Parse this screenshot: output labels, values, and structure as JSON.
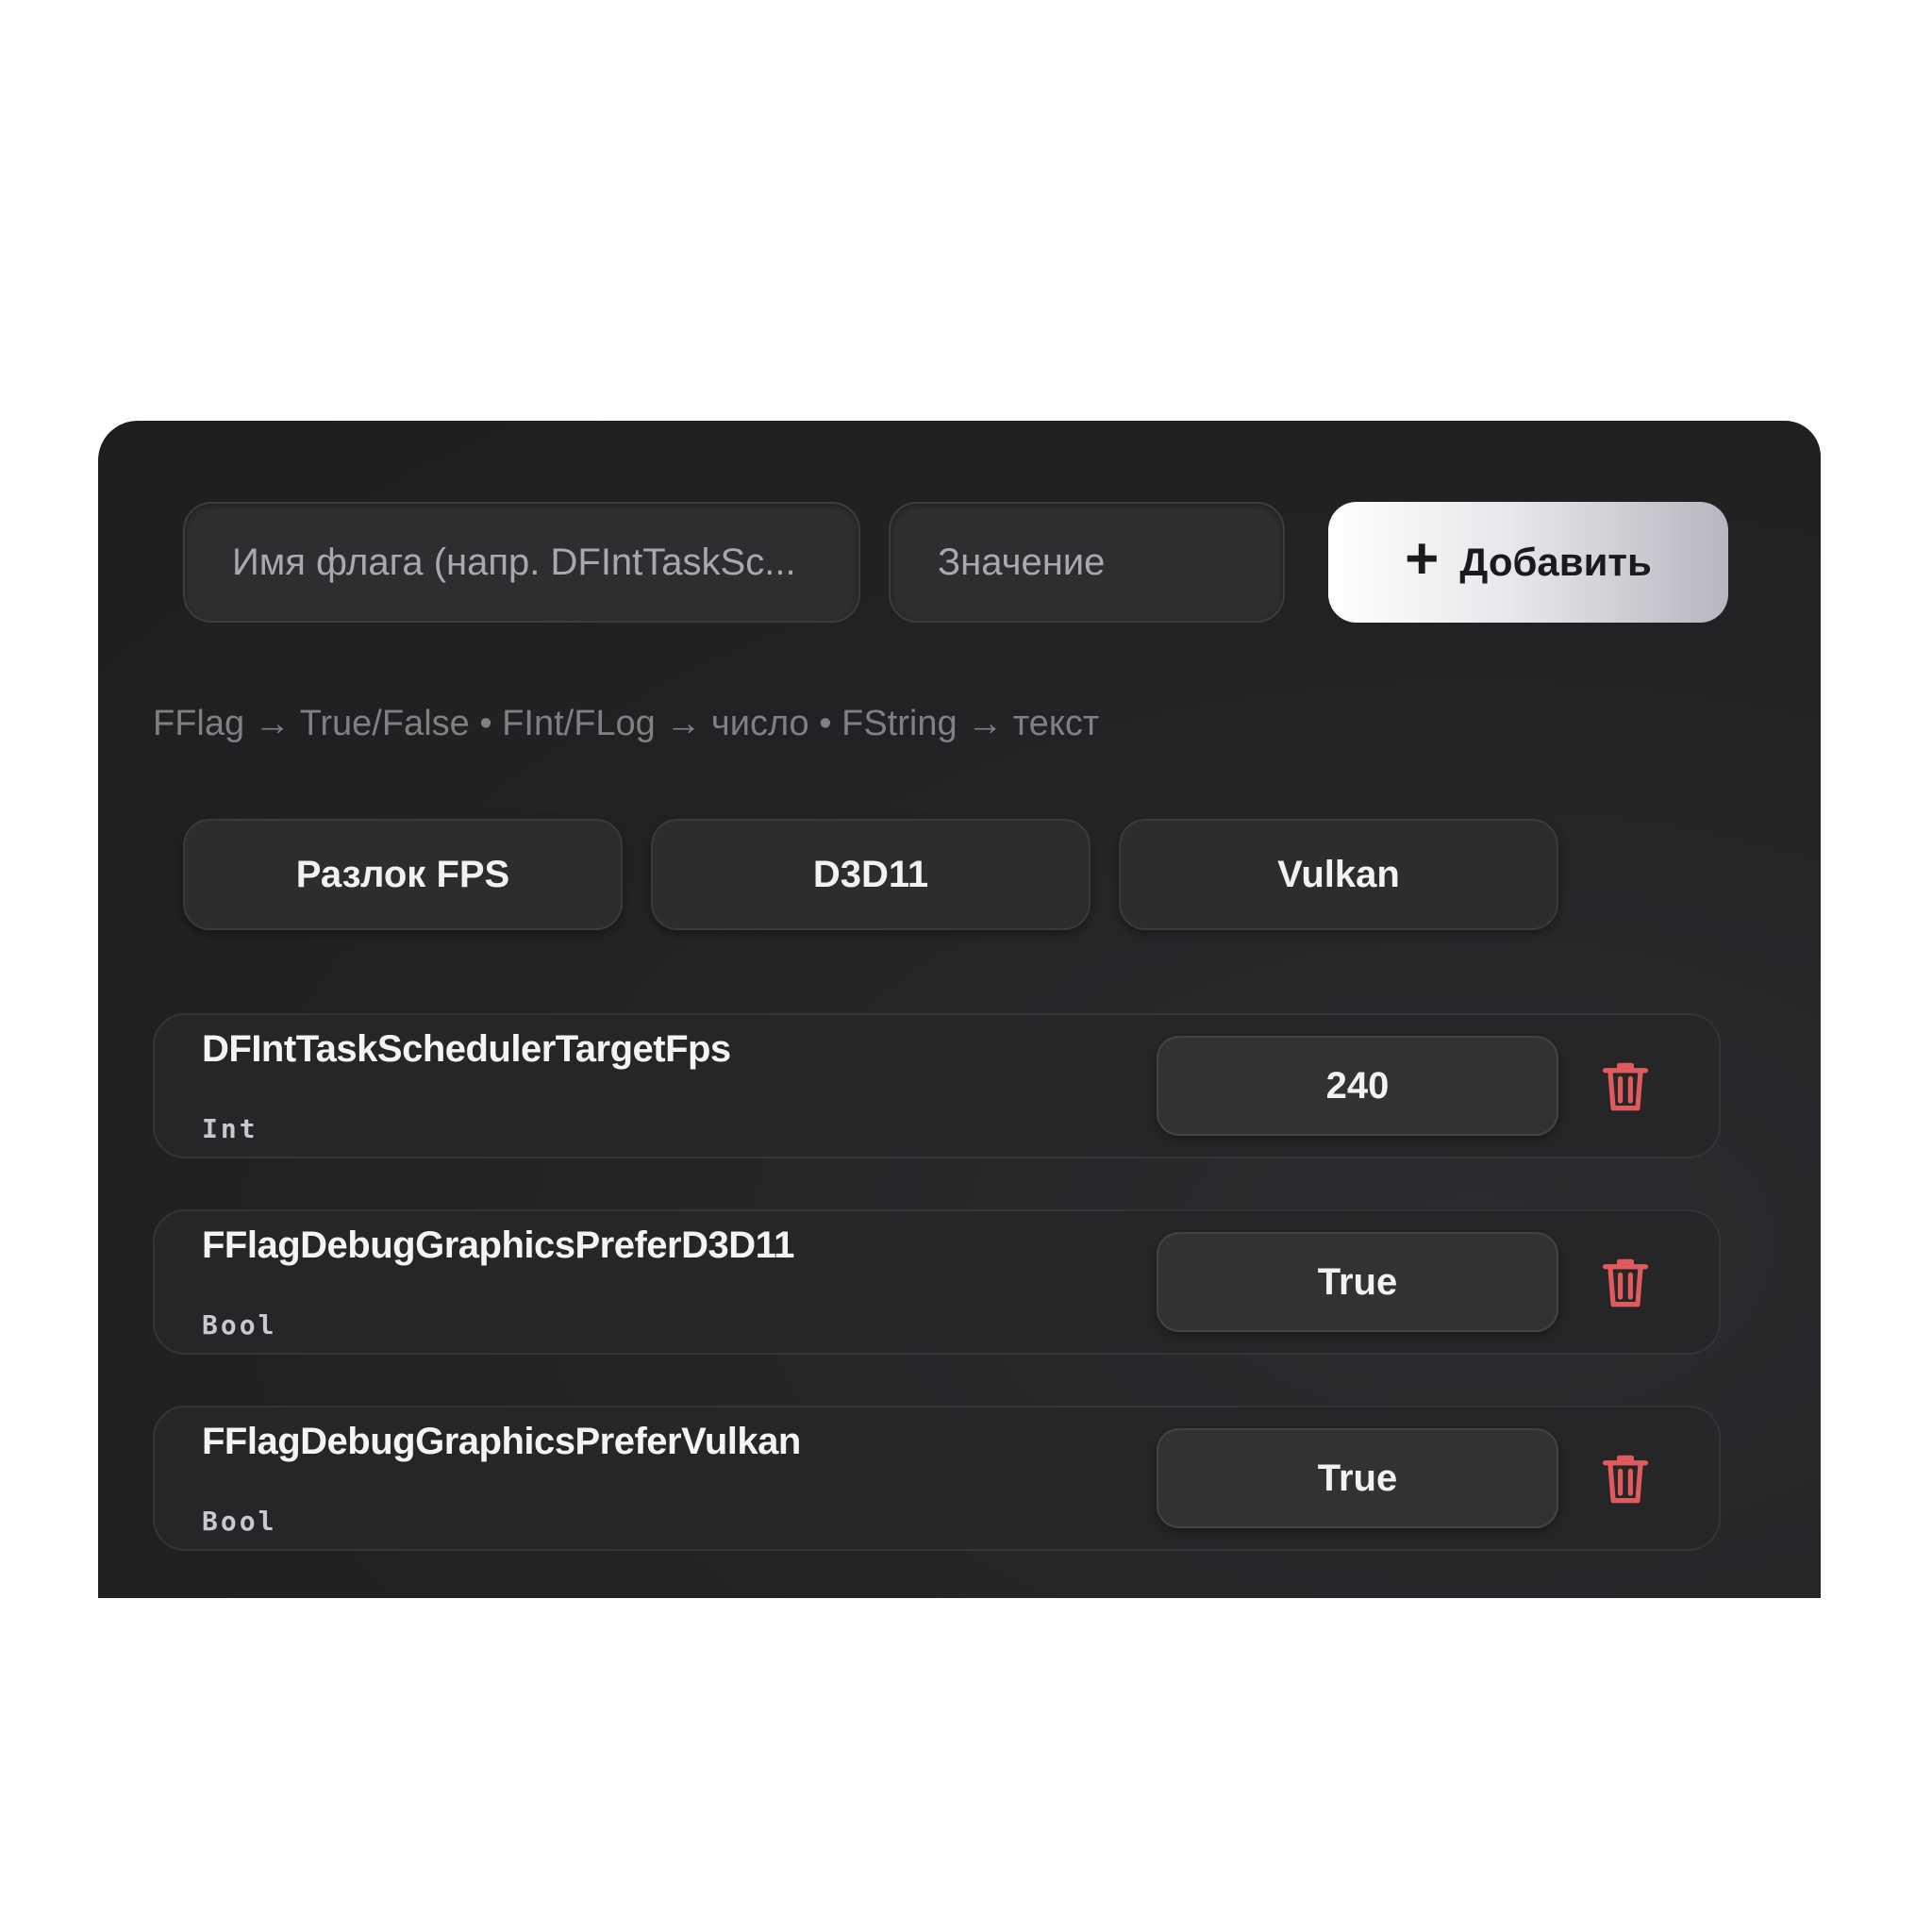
{
  "form": {
    "name_placeholder": "Имя флага  (напр. DFIntTaskSc...",
    "value_placeholder": "Значение",
    "add_label": "Добавить",
    "add_icon": "plus-icon"
  },
  "hint": "FFlag → True/False  •  FInt/FLog → число  •  FString → текст",
  "presets": [
    {
      "label": "Разлок FPS"
    },
    {
      "label": "D3D11"
    },
    {
      "label": "Vulkan"
    }
  ],
  "flags": [
    {
      "name": "DFIntTaskSchedulerTargetFps",
      "type": "Int",
      "value": "240",
      "delete_icon": "trash-icon"
    },
    {
      "name": "FFlagDebugGraphicsPreferD3D11",
      "type": "Bool",
      "value": "True",
      "delete_icon": "trash-icon"
    },
    {
      "name": "FFlagDebugGraphicsPreferVulkan",
      "type": "Bool",
      "value": "True",
      "delete_icon": "trash-icon"
    }
  ],
  "colors": {
    "panel_bg": "#222224",
    "delete_red": "#e05a5e",
    "add_button_light": "#ffffff",
    "add_button_dark": "#b7b6bf"
  }
}
